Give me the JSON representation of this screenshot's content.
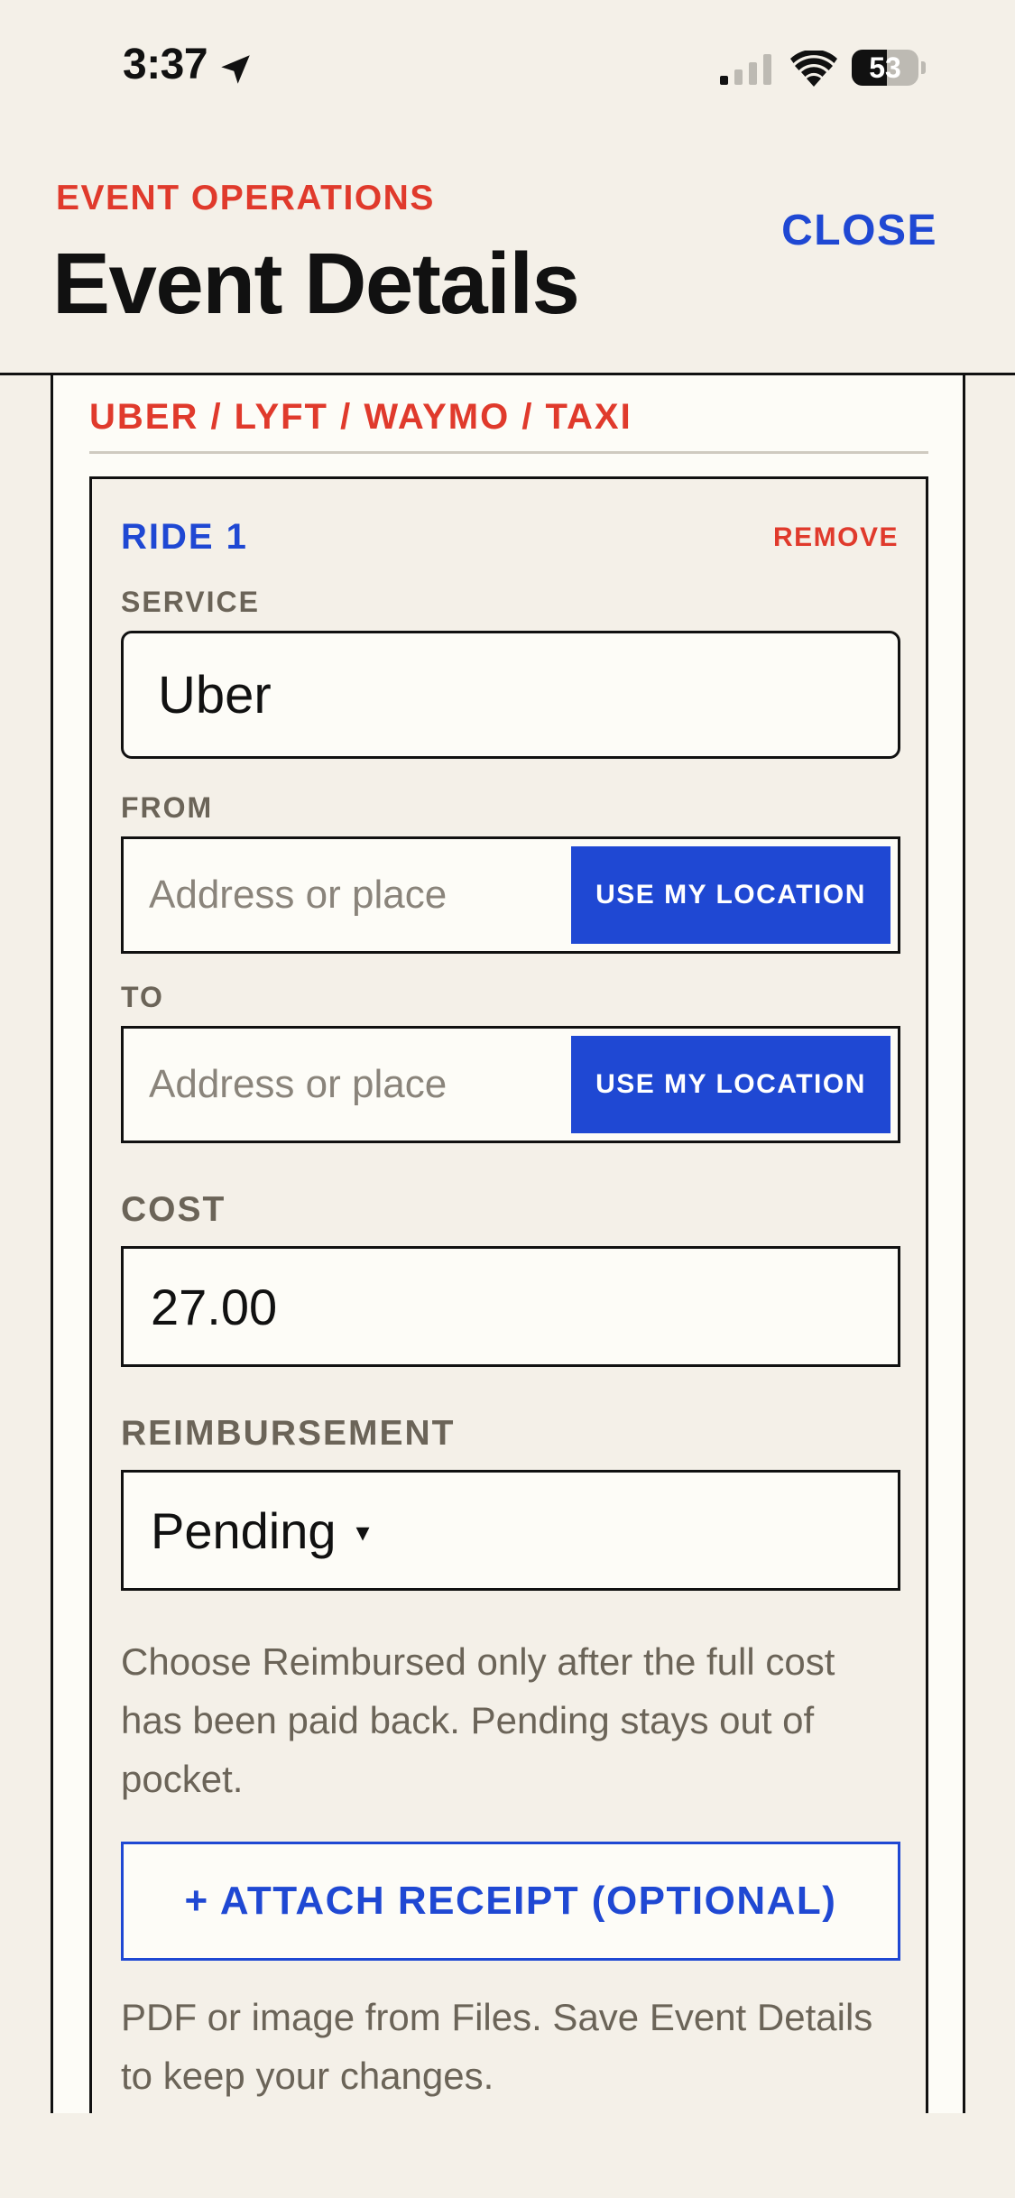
{
  "status_bar": {
    "time": "3:37",
    "battery_level": "53",
    "battery_fraction": 0.53,
    "signal_bars_active": 1,
    "icons": [
      "location-arrow-icon",
      "cellular-signal-icon",
      "wifi-icon",
      "battery-icon"
    ]
  },
  "header": {
    "eyebrow": "EVENT OPERATIONS",
    "title": "Event Details",
    "close_label": "CLOSE"
  },
  "section": {
    "title": "UBER / LYFT / WAYMO / TAXI"
  },
  "ride": {
    "title": "RIDE 1",
    "remove_label": "REMOVE",
    "service": {
      "label": "SERVICE",
      "value": "Uber"
    },
    "from": {
      "label": "FROM",
      "placeholder": "Address or place",
      "button_label": "USE MY LOCATION"
    },
    "to": {
      "label": "TO",
      "placeholder": "Address or place",
      "button_label": "USE MY LOCATION"
    },
    "cost": {
      "label": "COST",
      "value": "27.00"
    },
    "reimbursement": {
      "label": "REIMBURSEMENT",
      "value": "Pending",
      "arrow": "▾",
      "help": "Choose Reimbursed only after the full cost has been paid back. Pending stays out of pocket."
    },
    "attach": {
      "label": "+ ATTACH RECEIPT (OPTIONAL)",
      "help": "PDF or image from Files. Save Event Details to keep your changes."
    }
  },
  "colors": {
    "background": "#f4f0e8",
    "accent_red": "#e03a2c",
    "accent_blue": "#1f48d3",
    "ink": "#111111",
    "muted": "#6b6458"
  }
}
